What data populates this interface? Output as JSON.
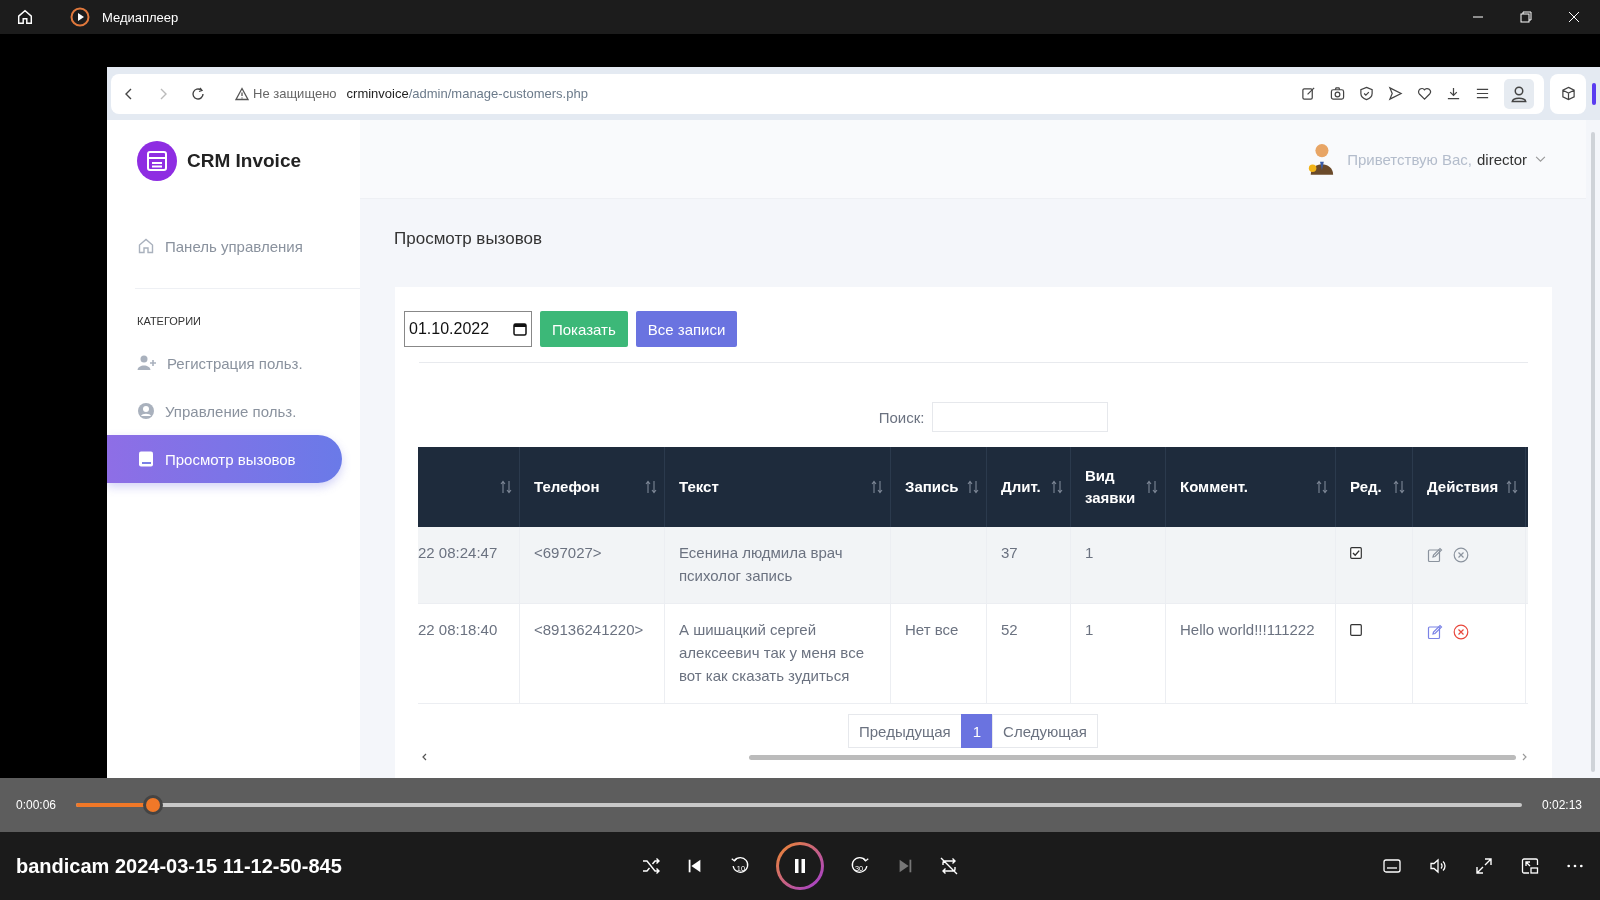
{
  "player": {
    "title": "Медиаплеер",
    "file_name": "bandicam 2024-03-15 11-12-50-845",
    "elapsed": "0:00:06",
    "total": "0:02:13",
    "level": 0.053,
    "rewind_label": "10",
    "forward_label": "30",
    "playing": true,
    "next_disabled": true
  },
  "browser": {
    "security": "Не защищено",
    "url_host": "crminvoice",
    "url_path": "/admin/manage-customers.php"
  },
  "app": {
    "logo": "CRM Invoice",
    "greeting": "Приветствую Вас,",
    "user": "director"
  },
  "sidebar": {
    "top_items": [
      {
        "label": "Панель управления",
        "selected": false
      }
    ],
    "category_heading": "КАТЕГОРИИ",
    "items": [
      {
        "label": "Регистрация польз.",
        "selected": false
      },
      {
        "label": "Управление польз.",
        "selected": false
      },
      {
        "label": "Просмотр вызовов",
        "selected": true
      }
    ]
  },
  "page": {
    "title": "Просмотр вызовов",
    "date": "01.10.2022",
    "buttons": [
      {
        "label": "Показать",
        "color": "#3cb878"
      },
      {
        "label": "Все записи",
        "color": "#6a73e0"
      }
    ],
    "search_label": "Поиск:",
    "table": {
      "columns": [
        {
          "sort_icon": true
        },
        {
          "label": "Телефон",
          "sort_icon": true
        },
        {
          "label": "Текст",
          "sort_icon": true
        },
        {
          "label": "Запись",
          "sort_icon": true
        },
        {
          "label": "Длит.",
          "sort_icon": true
        },
        {
          "label": "Вид заявки",
          "sort_icon": true
        },
        {
          "label": "Коммент.",
          "sort_icon": true
        },
        {
          "label": "Ред.",
          "sort_icon": true
        },
        {
          "label": "Действия",
          "sort_icon": true
        }
      ],
      "rows": [
        {
          "time": "22 08:24:47",
          "phone": "<697027>",
          "text": "Есенина людмила врач психолог запись",
          "record": "",
          "duration": "37",
          "type": "1",
          "comment": "",
          "checked": true,
          "highlighted": true
        },
        {
          "time": "22 08:18:40",
          "phone": "<89136241220>",
          "text": "А шишацкий сергей алексеевич так у меня все вот как сказать зудиться",
          "record": "Нет все",
          "duration": "52",
          "type": "1",
          "comment": "Hello world!!!111222",
          "checked": false,
          "highlighted": false
        }
      ]
    },
    "pagination": {
      "previous": "Предыдущая",
      "pages": [
        {
          "label": "1",
          "selected": true
        }
      ],
      "next": "Следующая"
    }
  }
}
